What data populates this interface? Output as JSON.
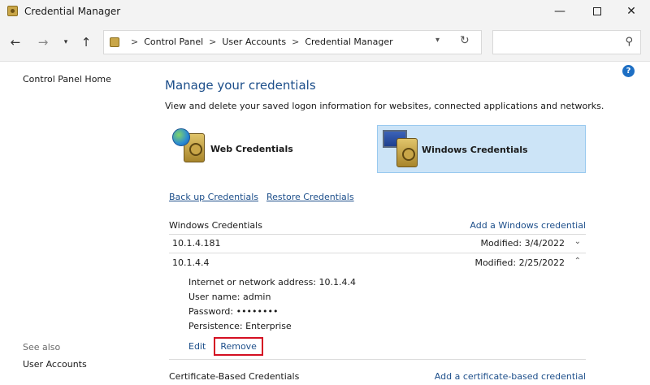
{
  "window": {
    "title": "Credential Manager",
    "minimize": "—",
    "close": "✕"
  },
  "nav": {
    "back": "←",
    "forward": "→",
    "recent": "▾",
    "up": "↑",
    "breadcrumbs": [
      "Control Panel",
      "User Accounts",
      "Credential Manager"
    ],
    "separator": ">",
    "dropdown": "▾",
    "refresh": "↻",
    "search_placeholder": ""
  },
  "left": {
    "home": "Control Panel Home",
    "see_also": "See also",
    "user_accounts": "User Accounts"
  },
  "help": "?",
  "main": {
    "heading": "Manage your credentials",
    "subheading": "View and delete your saved logon information for websites, connected applications and networks.",
    "web_tile": "Web Credentials",
    "windows_tile": "Windows Credentials",
    "backup": "Back up Credentials",
    "restore": "Restore Credentials",
    "windows_section": {
      "title": "Windows Credentials",
      "add": "Add a Windows credential",
      "items": [
        {
          "name": "10.1.4.181",
          "modified": "Modified:  3/4/2022",
          "chevron": "⌄"
        },
        {
          "name": "10.1.4.4",
          "modified": "Modified:  2/25/2022",
          "chevron": "⌃"
        }
      ],
      "details": [
        "Internet or network address:  10.1.4.4",
        "User name:  admin",
        "Password:  ••••••••",
        "Persistence:  Enterprise"
      ],
      "edit": "Edit",
      "remove": "Remove"
    },
    "cert_section": {
      "title": "Certificate-Based Credentials",
      "add": "Add a certificate-based credential"
    }
  }
}
